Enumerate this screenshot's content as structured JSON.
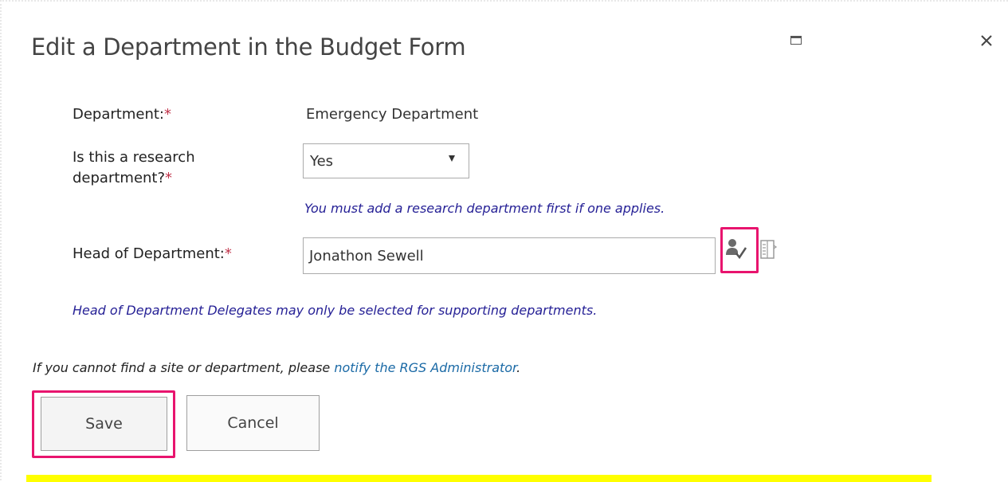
{
  "dialog": {
    "title": "Edit a Department in the Budget Form",
    "maximize_icon": "maximize-icon",
    "close_icon": "close-icon"
  },
  "form": {
    "department": {
      "label": "Department:",
      "required_mark": "*",
      "value": "Emergency Department"
    },
    "research": {
      "label_line1": "Is this a research",
      "label_line2": "department?",
      "required_mark": "*",
      "selected": "Yes",
      "hint": "You must add a research department first if one applies."
    },
    "head": {
      "label": "Head of Department:",
      "required_mark": "*",
      "value": "Jonathon Sewell",
      "check_names_icon": "check-names-icon",
      "browse_icon": "address-book-icon"
    },
    "delegates_hint": "Head of Department Delegates may only be selected for supporting departments."
  },
  "footer": {
    "note_prefix": "If you cannot find a site or department, please ",
    "note_link": "notify the RGS Administrator",
    "note_suffix": "."
  },
  "buttons": {
    "save": "Save",
    "cancel": "Cancel"
  },
  "colors": {
    "required": "#c0334a",
    "hint": "#262196",
    "link": "#1b6aa6",
    "highlight": "#e8146e",
    "yellow_bar": "#ffff00"
  }
}
